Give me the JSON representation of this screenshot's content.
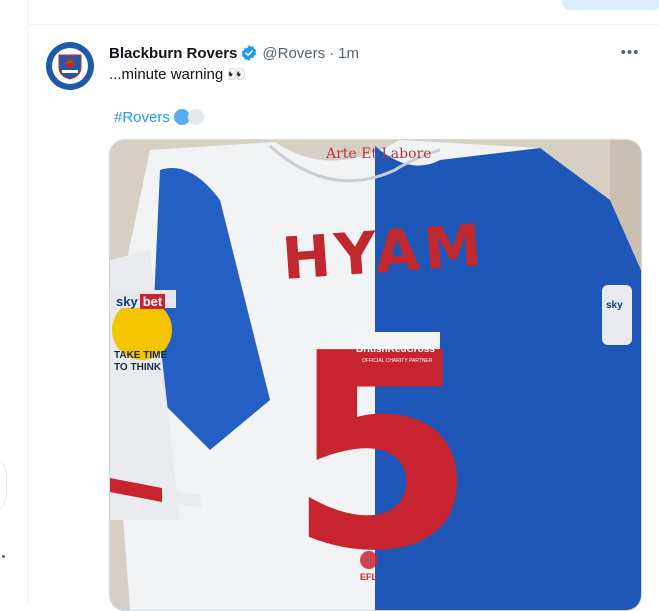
{
  "tweet": {
    "display_name": "Blackburn Rovers",
    "handle": "@Rovers",
    "separator": "·",
    "timestamp": "1m",
    "more_label": "•••",
    "text": "...minute warning 👀",
    "hashtag": "#Rovers"
  },
  "media": {
    "alt": "Blackburn Rovers shirt",
    "motto": "Arte Et Labore",
    "player_name": "HYAM",
    "number": "5",
    "sponsor_line1": "BritishRedCross",
    "sponsor_line2": "OFFICIAL CHARITY PARTNER",
    "league": "EFL",
    "sleeve_sky": "sky",
    "sleeve_bet": "bet",
    "sleeve_slogan_1": "TAKE TIME",
    "sleeve_slogan_2": "TO THINK",
    "sleeve_right": "sky"
  },
  "colors": {
    "accent": "#1d9bf0",
    "rovers_blue": "#1e5aa8",
    "number_red": "#c8242f"
  }
}
